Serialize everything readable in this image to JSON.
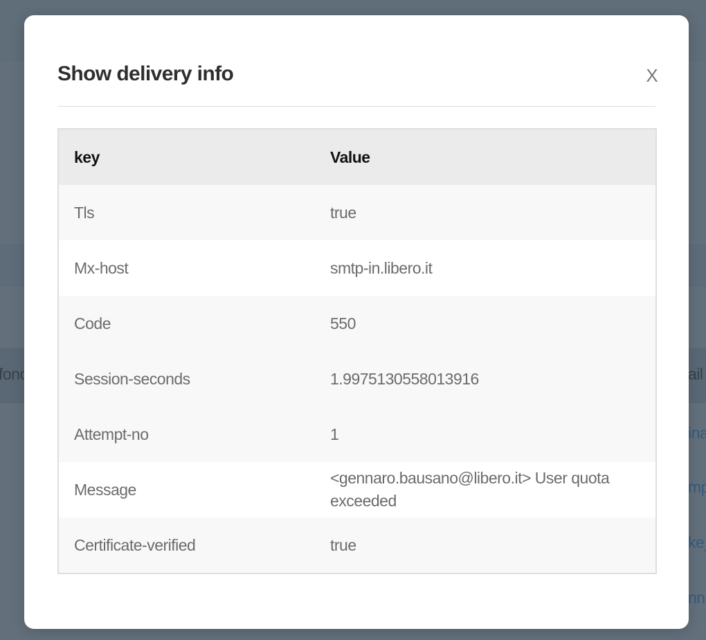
{
  "background": {
    "left_header_text": "fono",
    "right_header_text": "ail",
    "right_links": [
      "ina",
      "mp",
      "ke_",
      "nni"
    ]
  },
  "modal": {
    "title": "Show delivery info",
    "close_label": "X",
    "table": {
      "headers": [
        "key",
        "Value"
      ],
      "rows": [
        {
          "key": "Tls",
          "value": "true"
        },
        {
          "key": "Mx-host",
          "value": "smtp-in.libero.it"
        },
        {
          "key": "Code",
          "value": "550"
        },
        {
          "key": "Session-seconds",
          "value": "1.9975130558013916"
        },
        {
          "key": "Attempt-no",
          "value": "1"
        },
        {
          "key": "Message",
          "value": "<gennaro.bausano@libero.it> User quota exceeded"
        },
        {
          "key": "Certificate-verified",
          "value": "true"
        }
      ]
    }
  }
}
